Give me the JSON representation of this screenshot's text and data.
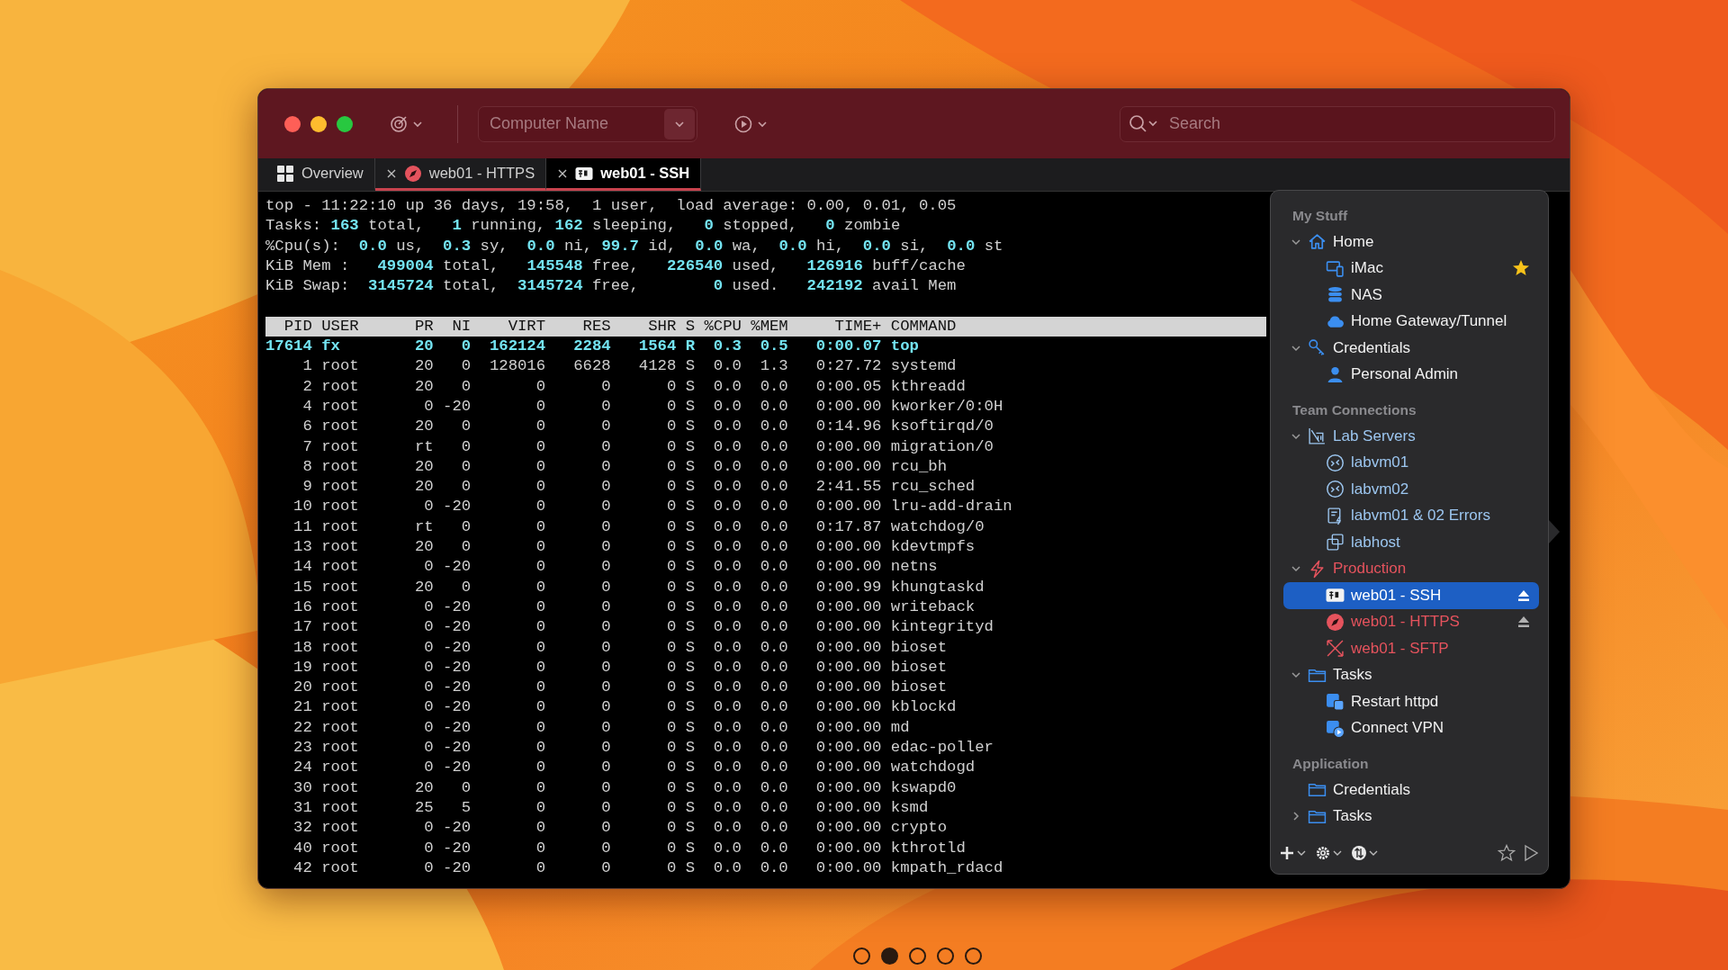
{
  "window": {
    "toolbar": {
      "computer_field": {
        "placeholder": "Computer Name"
      },
      "search": {
        "placeholder": "Search"
      }
    },
    "tabs": [
      {
        "kind": "overview",
        "label": "Overview",
        "selected": false
      },
      {
        "kind": "session",
        "label": "web01 - HTTPS",
        "selected": false
      },
      {
        "kind": "session",
        "label": "web01 - SSH",
        "selected": true
      }
    ],
    "terminal": {
      "summary": [
        "top - 11:22:10 up 36 days, 19:58,  1 user,  load average: 0.00, 0.01, 0.05",
        "Tasks: **163** total,   **1** running, **162** sleeping,   **0** stopped,   **0** zombie",
        "%Cpu(s):  **0.0** us,  **0.3** sy,  **0.0** ni, **99.7** id,  **0.0** wa,  **0.0** hi,  **0.0** si,  **0.0** st",
        "KiB Mem :   **499004** total,   **145548** free,   **226540** used,   **126916** buff/cache",
        "KiB Swap:  **3145724** total,  **3145724** free,        **0** used.   **242192** avail Mem"
      ],
      "header": "  PID USER      PR  NI    VIRT    RES    SHR S %CPU %MEM     TIME+ COMMAND",
      "rows": [
        {
          "text": "17614 fx        20   0  162124   2284   1564 R  0.3  0.5   0:00.07 top",
          "highlighted": true
        },
        {
          "text": "    1 root      20   0  128016   6628   4128 S  0.0  1.3   0:27.72 systemd",
          "highlighted": false
        },
        {
          "text": "    2 root      20   0       0      0      0 S  0.0  0.0   0:00.05 kthreadd",
          "highlighted": false
        },
        {
          "text": "    4 root       0 -20       0      0      0 S  0.0  0.0   0:00.00 kworker/0:0H",
          "highlighted": false
        },
        {
          "text": "    6 root      20   0       0      0      0 S  0.0  0.0   0:14.96 ksoftirqd/0",
          "highlighted": false
        },
        {
          "text": "    7 root      rt   0       0      0      0 S  0.0  0.0   0:00.00 migration/0",
          "highlighted": false
        },
        {
          "text": "    8 root      20   0       0      0      0 S  0.0  0.0   0:00.00 rcu_bh",
          "highlighted": false
        },
        {
          "text": "    9 root      20   0       0      0      0 S  0.0  0.0   2:41.55 rcu_sched",
          "highlighted": false
        },
        {
          "text": "   10 root       0 -20       0      0      0 S  0.0  0.0   0:00.00 lru-add-drain",
          "highlighted": false
        },
        {
          "text": "   11 root      rt   0       0      0      0 S  0.0  0.0   0:17.87 watchdog/0",
          "highlighted": false
        },
        {
          "text": "   13 root      20   0       0      0      0 S  0.0  0.0   0:00.00 kdevtmpfs",
          "highlighted": false
        },
        {
          "text": "   14 root       0 -20       0      0      0 S  0.0  0.0   0:00.00 netns",
          "highlighted": false
        },
        {
          "text": "   15 root      20   0       0      0      0 S  0.0  0.0   0:00.99 khungtaskd",
          "highlighted": false
        },
        {
          "text": "   16 root       0 -20       0      0      0 S  0.0  0.0   0:00.00 writeback",
          "highlighted": false
        },
        {
          "text": "   17 root       0 -20       0      0      0 S  0.0  0.0   0:00.00 kintegrityd",
          "highlighted": false
        },
        {
          "text": "   18 root       0 -20       0      0      0 S  0.0  0.0   0:00.00 bioset",
          "highlighted": false
        },
        {
          "text": "   19 root       0 -20       0      0      0 S  0.0  0.0   0:00.00 bioset",
          "highlighted": false
        },
        {
          "text": "   20 root       0 -20       0      0      0 S  0.0  0.0   0:00.00 bioset",
          "highlighted": false
        },
        {
          "text": "   21 root       0 -20       0      0      0 S  0.0  0.0   0:00.00 kblockd",
          "highlighted": false
        },
        {
          "text": "   22 root       0 -20       0      0      0 S  0.0  0.0   0:00.00 md",
          "highlighted": false
        },
        {
          "text": "   23 root       0 -20       0      0      0 S  0.0  0.0   0:00.00 edac-poller",
          "highlighted": false
        },
        {
          "text": "   24 root       0 -20       0      0      0 S  0.0  0.0   0:00.00 watchdogd",
          "highlighted": false
        },
        {
          "text": "   30 root      20   0       0      0      0 S  0.0  0.0   0:00.00 kswapd0",
          "highlighted": false
        },
        {
          "text": "   31 root      25   5       0      0      0 S  0.0  0.0   0:00.00 ksmd",
          "highlighted": false
        },
        {
          "text": "   32 root       0 -20       0      0      0 S  0.0  0.0   0:00.00 crypto",
          "highlighted": false
        },
        {
          "text": "   40 root       0 -20       0      0      0 S  0.0  0.0   0:00.00 kthrotld",
          "highlighted": false
        },
        {
          "text": "   42 root       0 -20       0      0      0 S  0.0  0.0   0:00.00 kmpath_rdacd",
          "highlighted": false
        }
      ]
    },
    "sidebar": {
      "sections": [
        {
          "title": "My Stuff",
          "items": [
            {
              "label": "Home",
              "color": "#f2f2f2",
              "expanded": true,
              "selected": false,
              "favorite": false,
              "connected": false,
              "children": [
                {
                  "label": "iMac",
                  "color": "#f2f2f2",
                  "selected": false,
                  "favorite": true,
                  "connected": false
                },
                {
                  "label": "NAS",
                  "color": "#f2f2f2",
                  "selected": false,
                  "favorite": false,
                  "connected": false
                },
                {
                  "label": "Home Gateway/Tunnel",
                  "color": "#f2f2f2",
                  "selected": false,
                  "favorite": false,
                  "connected": false
                }
              ]
            },
            {
              "label": "Credentials",
              "color": "#f2f2f2",
              "expanded": true,
              "selected": false,
              "favorite": false,
              "connected": false,
              "children": [
                {
                  "label": "Personal Admin",
                  "color": "#f2f2f2",
                  "selected": false,
                  "favorite": false,
                  "connected": false
                }
              ]
            }
          ]
        },
        {
          "title": "Team Connections",
          "items": [
            {
              "label": "Lab Servers",
              "color": "#9cc6f0",
              "expanded": true,
              "selected": false,
              "favorite": false,
              "connected": false,
              "children": [
                {
                  "label": "labvm01",
                  "color": "#9cc6f0",
                  "selected": false,
                  "favorite": false,
                  "connected": false
                },
                {
                  "label": "labvm02",
                  "color": "#9cc6f0",
                  "selected": false,
                  "favorite": false,
                  "connected": false
                },
                {
                  "label": "labvm01 & 02 Errors",
                  "color": "#9cc6f0",
                  "selected": false,
                  "favorite": false,
                  "connected": false
                },
                {
                  "label": "labhost",
                  "color": "#9cc6f0",
                  "selected": false,
                  "favorite": false,
                  "connected": false
                }
              ]
            },
            {
              "label": "Production",
              "color": "#e5535d",
              "expanded": true,
              "selected": false,
              "favorite": false,
              "connected": false,
              "children": [
                {
                  "label": "web01 - SSH",
                  "color": "#ffffff",
                  "selected": true,
                  "favorite": false,
                  "connected": true
                },
                {
                  "label": "web01 - HTTPS",
                  "color": "#e5535d",
                  "selected": false,
                  "favorite": false,
                  "connected": true
                },
                {
                  "label": "web01 - SFTP",
                  "color": "#e5535d",
                  "selected": false,
                  "favorite": false,
                  "connected": false
                }
              ]
            },
            {
              "label": "Tasks",
              "color": "#f2f2f2",
              "expanded": true,
              "selected": false,
              "favorite": false,
              "connected": false,
              "children": [
                {
                  "label": "Restart httpd",
                  "color": "#f2f2f2",
                  "selected": false,
                  "favorite": false,
                  "connected": false
                },
                {
                  "label": "Connect VPN",
                  "color": "#f2f2f2",
                  "selected": false,
                  "favorite": false,
                  "connected": false
                }
              ]
            }
          ]
        },
        {
          "title": "Application",
          "items": [
            {
              "label": "Credentials",
              "color": "#f2f2f2",
              "selected": false,
              "favorite": false,
              "connected": false
            },
            {
              "label": "Tasks",
              "color": "#f2f2f2",
              "expanded": false,
              "selected": false,
              "favorite": false,
              "connected": false
            }
          ]
        }
      ]
    }
  },
  "pager": [
    {
      "selected": false
    },
    {
      "selected": true
    },
    {
      "selected": false
    },
    {
      "selected": false
    },
    {
      "selected": false
    }
  ]
}
